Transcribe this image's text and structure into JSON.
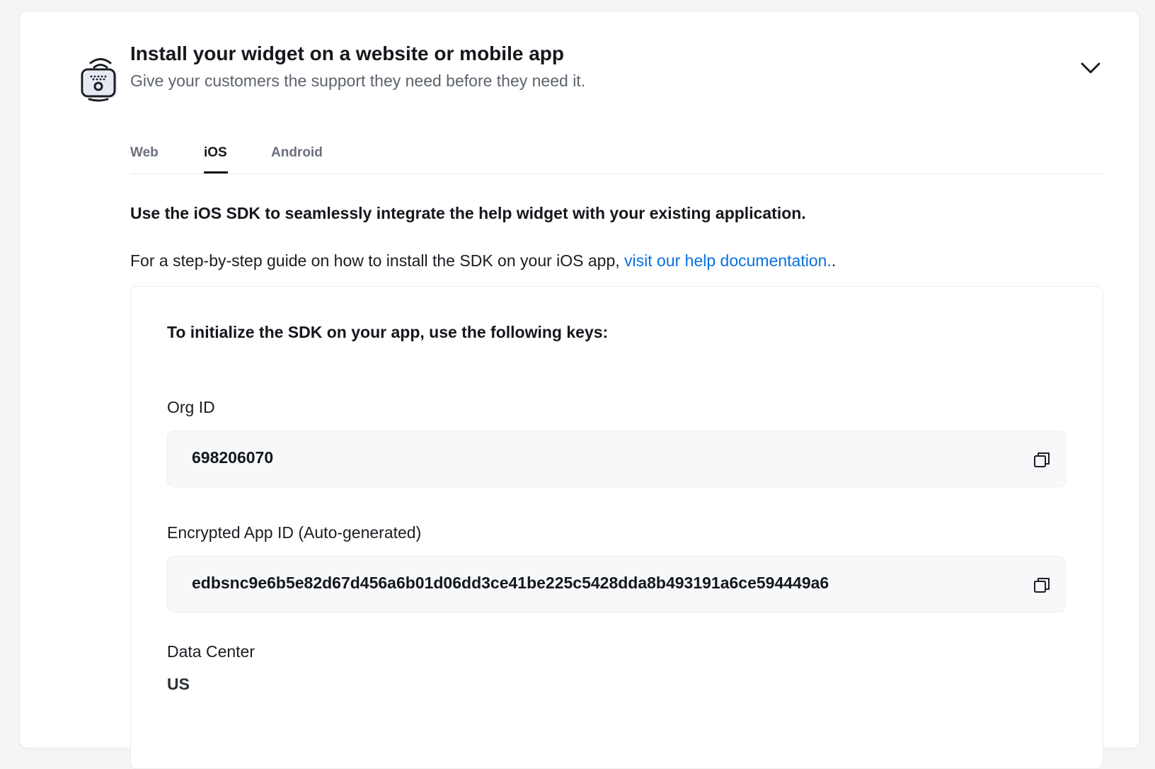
{
  "header": {
    "title": "Install your widget on a website or mobile app",
    "subtitle": "Give your customers the support they need before they need it.",
    "icon": "widget-install-icon",
    "collapse_icon": "chevron-down-icon"
  },
  "tabs": [
    {
      "label": "Web",
      "active": false
    },
    {
      "label": "iOS",
      "active": true
    },
    {
      "label": "Android",
      "active": false
    }
  ],
  "content": {
    "intro": "Use the iOS SDK to seamlessly integrate the help widget with your existing application.",
    "guide_prefix": "For a step-by-step guide on how to install the SDK on your iOS app, ",
    "guide_link": "visit our help documentation.",
    "guide_suffix": "."
  },
  "keys": {
    "heading": "To initialize the SDK on your app, use the following keys:",
    "org_id": {
      "label": "Org ID",
      "value": "698206070"
    },
    "app_id": {
      "label": "Encrypted App ID (Auto-generated)",
      "value": "edbsnc9e6b5e82d67d456a6b01d06dd3ce41be225c5428dda8b493191a6ce594449a6"
    },
    "data_center": {
      "label": "Data Center",
      "value": "US"
    }
  },
  "colors": {
    "link": "#0a70e0",
    "text": "#14171c",
    "muted": "#5d636d",
    "key_box_bg": "#f7f8fa"
  }
}
